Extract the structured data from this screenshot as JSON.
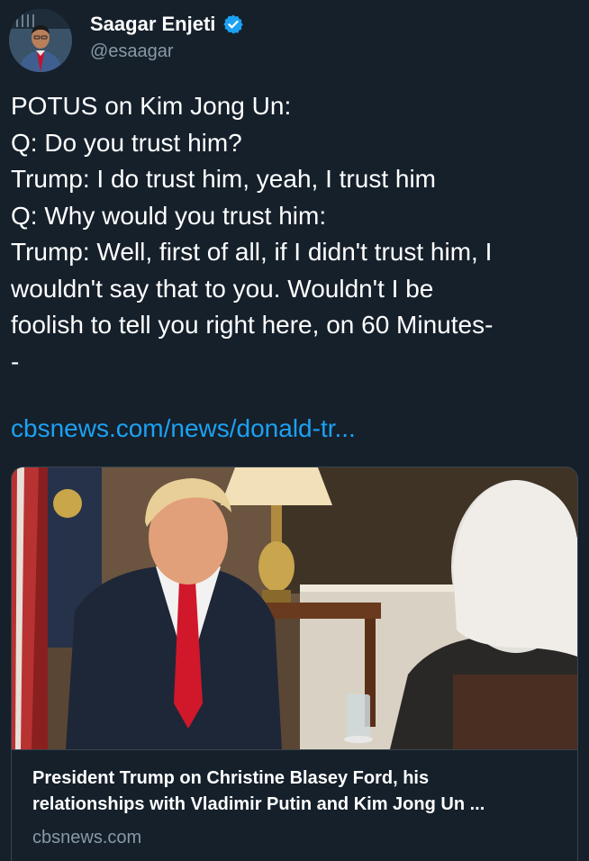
{
  "author": {
    "display_name": "Saagar Enjeti",
    "handle": "@esaagar",
    "verified": true,
    "avatar_icon": "user-avatar"
  },
  "tweet": {
    "lines": [
      "POTUS on Kim Jong Un:",
      "Q: Do you trust him?",
      "Trump: I do trust him, yeah, I trust him",
      "Q: Why would you trust him:",
      "Trump: Well, first of all, if I didn't trust him, I",
      "wouldn't say that to you. Wouldn't I be",
      "foolish to tell you right here, on 60 Minutes-",
      "-"
    ],
    "link": "cbsnews.com/news/donald-tr..."
  },
  "card": {
    "image_icon": "interview-photo",
    "title_lines": [
      "President Trump on Christine Blasey Ford, his",
      "relationships with Vladimir Putin and Kim Jong Un ..."
    ],
    "domain": "cbsnews.com"
  },
  "colors": {
    "background": "#15202b",
    "text": "#ffffff",
    "secondary_text": "#8899a6",
    "link": "#1da1f2",
    "border": "#38444d"
  }
}
